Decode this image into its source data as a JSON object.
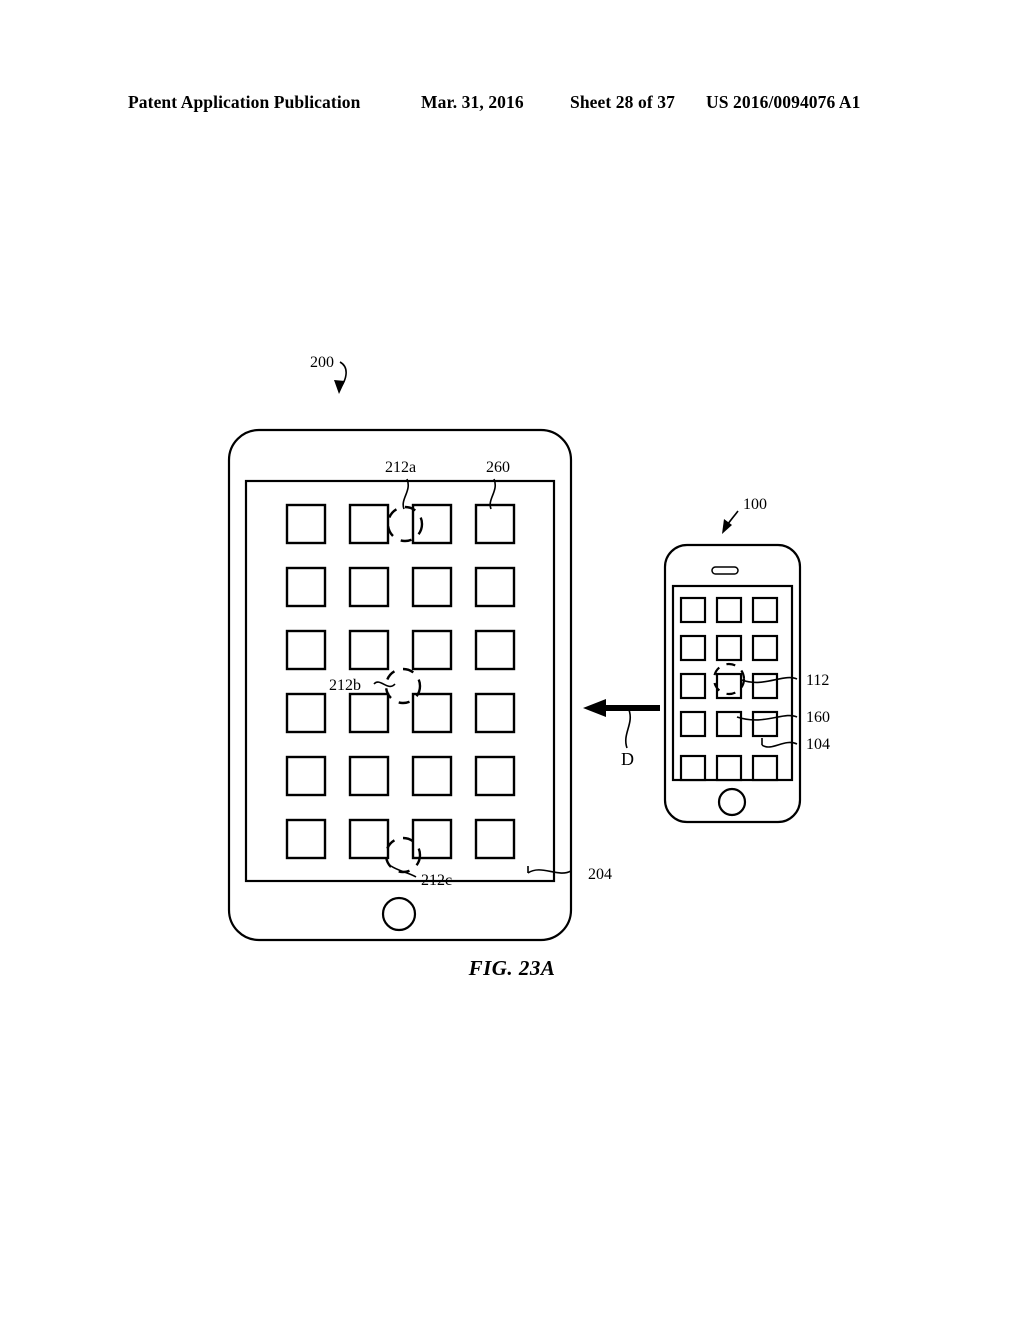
{
  "header": {
    "publication": "Patent Application Publication",
    "date": "Mar. 31, 2016",
    "sheet": "Sheet 28 of 37",
    "number": "US 2016/0094076 A1"
  },
  "figure": {
    "caption": "FIG. 23A",
    "colors": {
      "ink": "#000000",
      "background": "#ffffff"
    }
  },
  "labels": {
    "device_tablet": "200",
    "tablet_display": "204",
    "tablet_icon": "260",
    "contact_a": "212a",
    "contact_b": "212b",
    "contact_c": "212c",
    "device_phone": "100",
    "phone_contact": "112",
    "phone_icon": "160",
    "phone_display": "104",
    "direction": "D"
  },
  "tablet": {
    "name": "tablet-device",
    "icon_rows": 6,
    "icon_cols": 4,
    "icon_count": 24,
    "home_button": "home-button",
    "touch_points": [
      "212a",
      "212b",
      "212c"
    ]
  },
  "phone": {
    "name": "phone-device",
    "icon_rows": 5,
    "icon_cols": 3,
    "icon_count": 15,
    "speaker": "speaker-slot",
    "home_button": "home-button",
    "touch_points": [
      "112"
    ]
  },
  "arrow": {
    "name": "direction-arrow",
    "label": "D",
    "points": "left"
  }
}
